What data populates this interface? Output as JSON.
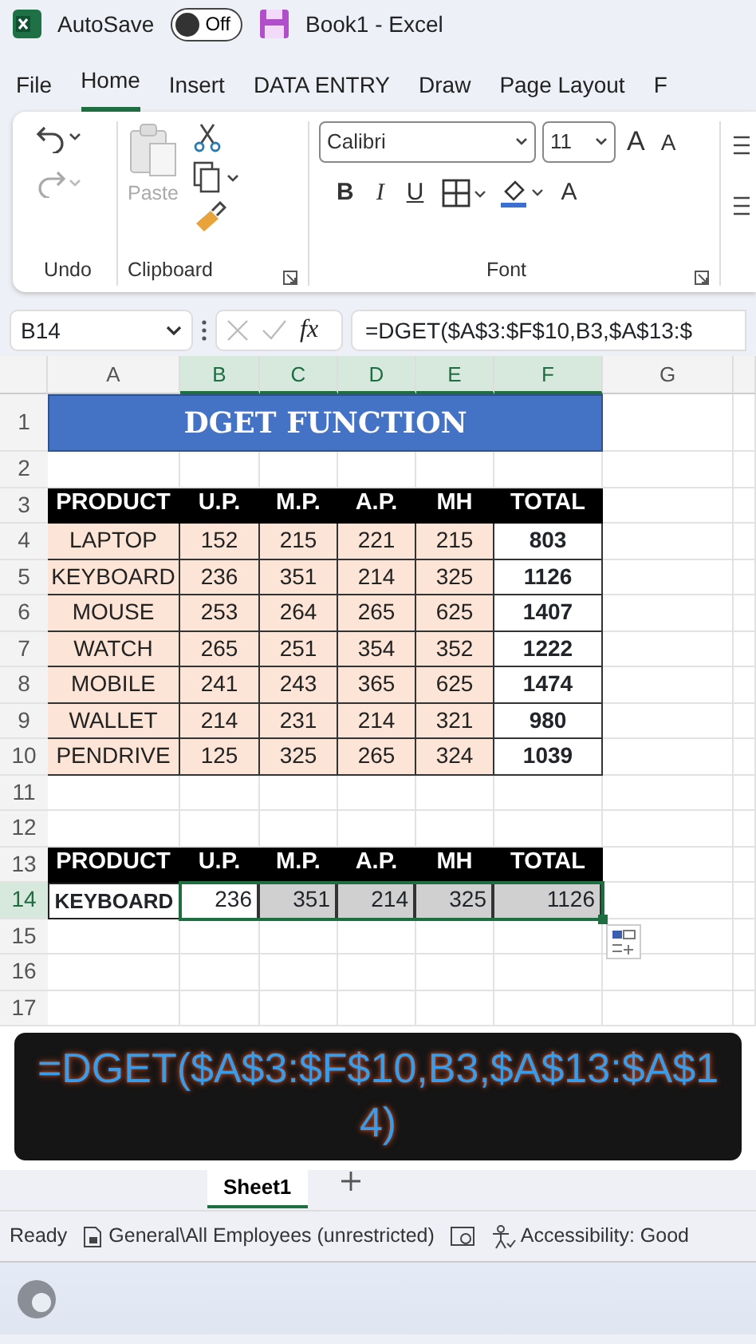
{
  "title_bar": {
    "autosave_label": "AutoSave",
    "autosave_on": false,
    "toggle_text": "Off",
    "title": "Book1  -  Excel"
  },
  "ribbon_tabs": [
    {
      "label": "File",
      "selected": false
    },
    {
      "label": "Home",
      "selected": true
    },
    {
      "label": "Insert",
      "selected": false
    },
    {
      "label": "DATA ENTRY",
      "selected": false
    },
    {
      "label": "Draw",
      "selected": false
    },
    {
      "label": "Page Layout",
      "selected": false
    },
    {
      "label": "F",
      "selected": false
    }
  ],
  "ribbon": {
    "undo_group": "Undo",
    "paste_label": "Paste",
    "clipboard_group": "Clipboard",
    "font_name": "Calibri",
    "font_size": "11",
    "grow_font": "A",
    "shrink_font": "A",
    "format_buttons": [
      {
        "label": "B",
        "kind": "bold"
      },
      {
        "label": "I",
        "kind": "italic"
      },
      {
        "label": "U",
        "kind": "underline"
      }
    ],
    "font_color": "A",
    "font_group": "Font"
  },
  "formula_bar": {
    "name_box": "B14",
    "fx": "fx",
    "formula": "=DGET($A$3:$F$10,B3,$A$13:$"
  },
  "sheet": {
    "columns": [
      {
        "label": "A",
        "selected": false
      },
      {
        "label": "B",
        "selected": true
      },
      {
        "label": "C",
        "selected": true
      },
      {
        "label": "D",
        "selected": true
      },
      {
        "label": "E",
        "selected": true
      },
      {
        "label": "F",
        "selected": true
      },
      {
        "label": "G",
        "selected": false
      }
    ],
    "rows": [
      {
        "number": "1",
        "selected": false,
        "title": "DGET FUNCTION",
        "cells": []
      },
      {
        "number": "2",
        "selected": false,
        "cells": []
      },
      {
        "number": "3",
        "selected": false,
        "cells": [
          {
            "text": "PRODUCT",
            "kind": "header",
            "selected": false
          },
          {
            "text": "U.P.",
            "kind": "header",
            "selected": false
          },
          {
            "text": "M.P.",
            "kind": "header",
            "selected": false
          },
          {
            "text": "A.P.",
            "kind": "header",
            "selected": false
          },
          {
            "text": "MH",
            "kind": "header",
            "selected": false
          },
          {
            "text": "TOTAL",
            "kind": "header",
            "selected": false
          }
        ]
      },
      {
        "number": "4",
        "selected": false,
        "cells": [
          {
            "text": "LAPTOP",
            "kind": "data",
            "selected": false
          },
          {
            "text": "152",
            "kind": "data",
            "selected": false
          },
          {
            "text": "215",
            "kind": "data",
            "selected": false
          },
          {
            "text": "221",
            "kind": "data",
            "selected": false
          },
          {
            "text": "215",
            "kind": "data",
            "selected": false
          },
          {
            "text": "803",
            "kind": "total",
            "selected": false
          }
        ]
      },
      {
        "number": "5",
        "selected": false,
        "cells": [
          {
            "text": "KEYBOARD",
            "kind": "data",
            "selected": false
          },
          {
            "text": "236",
            "kind": "data",
            "selected": false
          },
          {
            "text": "351",
            "kind": "data",
            "selected": false
          },
          {
            "text": "214",
            "kind": "data",
            "selected": false
          },
          {
            "text": "325",
            "kind": "data",
            "selected": false
          },
          {
            "text": "1126",
            "kind": "total",
            "selected": false
          }
        ]
      },
      {
        "number": "6",
        "selected": false,
        "cells": [
          {
            "text": "MOUSE",
            "kind": "data",
            "selected": false
          },
          {
            "text": "253",
            "kind": "data",
            "selected": false
          },
          {
            "text": "264",
            "kind": "data",
            "selected": false
          },
          {
            "text": "265",
            "kind": "data",
            "selected": false
          },
          {
            "text": "625",
            "kind": "data",
            "selected": false
          },
          {
            "text": "1407",
            "kind": "total",
            "selected": false
          }
        ]
      },
      {
        "number": "7",
        "selected": false,
        "cells": [
          {
            "text": "WATCH",
            "kind": "data",
            "selected": false
          },
          {
            "text": "265",
            "kind": "data",
            "selected": false
          },
          {
            "text": "251",
            "kind": "data",
            "selected": false
          },
          {
            "text": "354",
            "kind": "data",
            "selected": false
          },
          {
            "text": "352",
            "kind": "data",
            "selected": false
          },
          {
            "text": "1222",
            "kind": "total",
            "selected": false
          }
        ]
      },
      {
        "number": "8",
        "selected": false,
        "cells": [
          {
            "text": "MOBILE",
            "kind": "data",
            "selected": false
          },
          {
            "text": "241",
            "kind": "data",
            "selected": false
          },
          {
            "text": "243",
            "kind": "data",
            "selected": false
          },
          {
            "text": "365",
            "kind": "data",
            "selected": false
          },
          {
            "text": "625",
            "kind": "data",
            "selected": false
          },
          {
            "text": "1474",
            "kind": "total",
            "selected": false
          }
        ]
      },
      {
        "number": "9",
        "selected": false,
        "cells": [
          {
            "text": "WALLET",
            "kind": "data",
            "selected": false
          },
          {
            "text": "214",
            "kind": "data",
            "selected": false
          },
          {
            "text": "231",
            "kind": "data",
            "selected": false
          },
          {
            "text": "214",
            "kind": "data",
            "selected": false
          },
          {
            "text": "321",
            "kind": "data",
            "selected": false
          },
          {
            "text": "980",
            "kind": "total",
            "selected": false
          }
        ]
      },
      {
        "number": "10",
        "selected": false,
        "cells": [
          {
            "text": "PENDRIVE",
            "kind": "data",
            "selected": false
          },
          {
            "text": "125",
            "kind": "data",
            "selected": false
          },
          {
            "text": "325",
            "kind": "data",
            "selected": false
          },
          {
            "text": "265",
            "kind": "data",
            "selected": false
          },
          {
            "text": "324",
            "kind": "data",
            "selected": false
          },
          {
            "text": "1039",
            "kind": "total",
            "selected": false
          }
        ]
      },
      {
        "number": "11",
        "selected": false,
        "cells": []
      },
      {
        "number": "12",
        "selected": false,
        "cells": []
      },
      {
        "number": "13",
        "selected": false,
        "cells": [
          {
            "text": "PRODUCT",
            "kind": "header",
            "selected": false
          },
          {
            "text": "U.P.",
            "kind": "header",
            "selected": false
          },
          {
            "text": "M.P.",
            "kind": "header",
            "selected": false
          },
          {
            "text": "A.P.",
            "kind": "header",
            "selected": false
          },
          {
            "text": "MH",
            "kind": "header",
            "selected": false
          },
          {
            "text": "TOTAL",
            "kind": "header",
            "selected": false
          }
        ]
      },
      {
        "number": "14",
        "selected": true,
        "cells": [
          {
            "text": "KEYBOARD",
            "kind": "key",
            "selected": false
          },
          {
            "text": "236",
            "kind": "result",
            "selected": true
          },
          {
            "text": "351",
            "kind": "result",
            "selected": true
          },
          {
            "text": "214",
            "kind": "result",
            "selected": true
          },
          {
            "text": "325",
            "kind": "result",
            "selected": true
          },
          {
            "text": "1126",
            "kind": "result",
            "selected": true
          }
        ]
      },
      {
        "number": "15",
        "selected": false,
        "cells": []
      },
      {
        "number": "16",
        "selected": false,
        "cells": []
      },
      {
        "number": "17",
        "selected": false,
        "cells": []
      }
    ]
  },
  "caption": "=DGET($A$3:$F$10,B3,$A$13:$A$14)",
  "sheet_tabs": [
    {
      "label": "Sheet1",
      "selected": true
    }
  ],
  "status_bar": {
    "ready": "Ready",
    "sensitivity": "General\\All Employees (unrestricted)",
    "accessibility": "Accessibility: Good"
  }
}
